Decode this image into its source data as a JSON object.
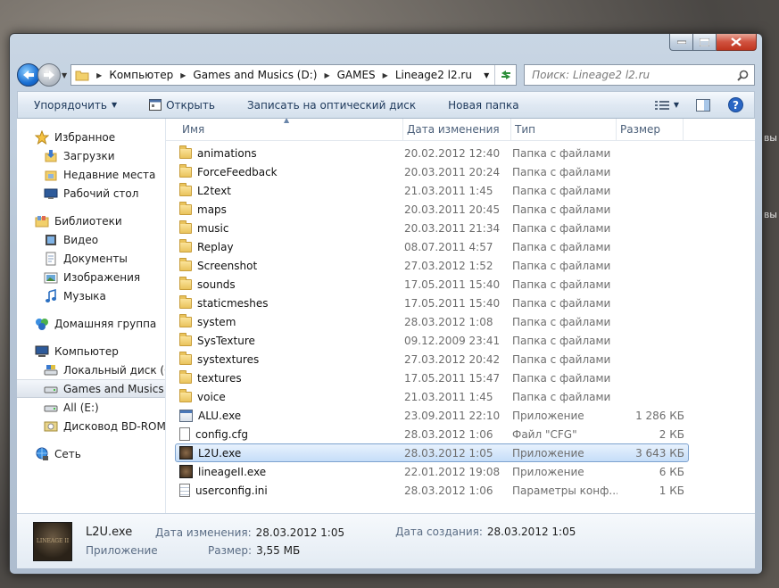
{
  "desktop": {
    "right_text_1": "вы",
    "right_text_2": "вы"
  },
  "window": {
    "caption_buttons": {
      "min_icon": "minimize-icon",
      "max_icon": "maximize-icon",
      "close_icon": "close-icon"
    }
  },
  "nav": {
    "breadcrumbs": [
      "Компьютер",
      "Games and Musics (D:)",
      "GAMES",
      "Lineage2 l2.ru"
    ],
    "search_placeholder": "Поиск: Lineage2 l2.ru"
  },
  "toolbar": {
    "organize": "Упорядочить",
    "open": "Открыть",
    "burn": "Записать на оптический диск",
    "new_folder": "Новая папка"
  },
  "sidebar": {
    "favorites": {
      "label": "Избранное",
      "items": [
        "Загрузки",
        "Недавние места",
        "Рабочий стол"
      ]
    },
    "libraries": {
      "label": "Библиотеки",
      "items": [
        "Видео",
        "Документы",
        "Изображения",
        "Музыка"
      ]
    },
    "homegroup": "Домашняя группа",
    "computer": {
      "label": "Компьютер",
      "items": [
        "Локальный диск (C",
        "Games and Musics (",
        "All (E:)",
        "Дисковод BD-ROM"
      ]
    },
    "network": "Сеть"
  },
  "columns": {
    "name": "Имя",
    "date": "Дата изменения",
    "type": "Тип",
    "size": "Размер"
  },
  "files": [
    {
      "name": "animations",
      "date": "20.02.2012 12:40",
      "type": "Папка с файлами",
      "size": "",
      "kind": "folder"
    },
    {
      "name": "ForceFeedback",
      "date": "20.03.2011 20:24",
      "type": "Папка с файлами",
      "size": "",
      "kind": "folder"
    },
    {
      "name": "L2text",
      "date": "21.03.2011 1:45",
      "type": "Папка с файлами",
      "size": "",
      "kind": "folder"
    },
    {
      "name": "maps",
      "date": "20.03.2011 20:45",
      "type": "Папка с файлами",
      "size": "",
      "kind": "folder"
    },
    {
      "name": "music",
      "date": "20.03.2011 21:34",
      "type": "Папка с файлами",
      "size": "",
      "kind": "folder"
    },
    {
      "name": "Replay",
      "date": "08.07.2011 4:57",
      "type": "Папка с файлами",
      "size": "",
      "kind": "folder"
    },
    {
      "name": "Screenshot",
      "date": "27.03.2012 1:52",
      "type": "Папка с файлами",
      "size": "",
      "kind": "folder"
    },
    {
      "name": "sounds",
      "date": "17.05.2011 15:40",
      "type": "Папка с файлами",
      "size": "",
      "kind": "folder"
    },
    {
      "name": "staticmeshes",
      "date": "17.05.2011 15:40",
      "type": "Папка с файлами",
      "size": "",
      "kind": "folder"
    },
    {
      "name": "system",
      "date": "28.03.2012 1:08",
      "type": "Папка с файлами",
      "size": "",
      "kind": "folder"
    },
    {
      "name": "SysTexture",
      "date": "09.12.2009 23:41",
      "type": "Папка с файлами",
      "size": "",
      "kind": "folder"
    },
    {
      "name": "systextures",
      "date": "27.03.2012 20:42",
      "type": "Папка с файлами",
      "size": "",
      "kind": "folder"
    },
    {
      "name": "textures",
      "date": "17.05.2011 15:47",
      "type": "Папка с файлами",
      "size": "",
      "kind": "folder"
    },
    {
      "name": "voice",
      "date": "21.03.2011 1:45",
      "type": "Папка с файлами",
      "size": "",
      "kind": "folder"
    },
    {
      "name": "ALU.exe",
      "date": "23.09.2011 22:10",
      "type": "Приложение",
      "size": "1 286 КБ",
      "kind": "exe"
    },
    {
      "name": "config.cfg",
      "date": "28.03.2012 1:06",
      "type": "Файл \"CFG\"",
      "size": "2 КБ",
      "kind": "cfg"
    },
    {
      "name": "L2U.exe",
      "date": "28.03.2012 1:05",
      "type": "Приложение",
      "size": "3 643 КБ",
      "kind": "game",
      "selected": true
    },
    {
      "name": "lineageII.exe",
      "date": "22.01.2012 19:08",
      "type": "Приложение",
      "size": "6 КБ",
      "kind": "game"
    },
    {
      "name": "userconfig.ini",
      "date": "28.03.2012 1:06",
      "type": "Параметры конф...",
      "size": "1 КБ",
      "kind": "ini"
    }
  ],
  "details": {
    "thumb_text": "LINEAGE II",
    "name": "L2U.exe",
    "kind": "Приложение",
    "modified_label": "Дата изменения:",
    "modified": "28.03.2012 1:05",
    "created_label": "Дата создания:",
    "created": "28.03.2012 1:05",
    "size_label": "Размер:",
    "size": "3,55 МБ"
  }
}
